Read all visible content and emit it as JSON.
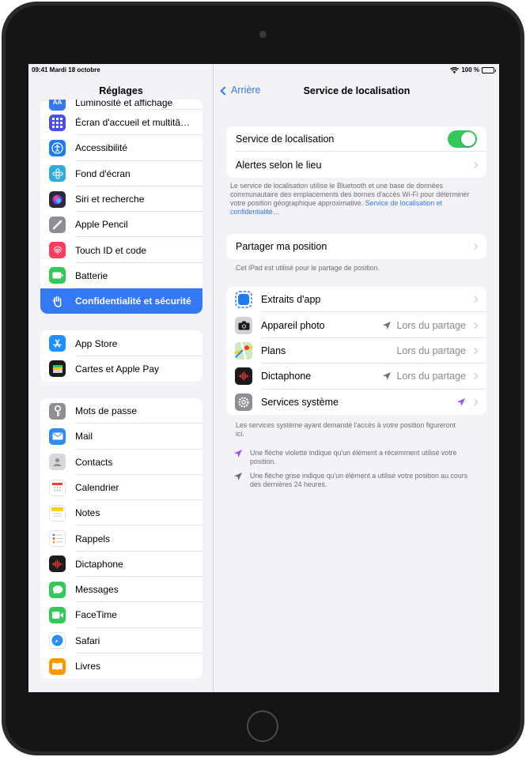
{
  "statusbar": {
    "time_date": "09:41  Mardi 18 octobre",
    "battery": "100 %"
  },
  "sidebar": {
    "title": "Réglages",
    "groups": [
      [
        {
          "label": "Luminosité et affichage",
          "color": "#3478f6"
        },
        {
          "label": "Écran d'accueil et multitâ…",
          "color": "#4b4de8"
        },
        {
          "label": "Accessibilité",
          "color": "#1e7cf2"
        },
        {
          "label": "Fond d'écran",
          "color": "#34aadc"
        },
        {
          "label": "Siri et recherche",
          "color": "#2a2a3a"
        },
        {
          "label": "Apple Pencil",
          "color": "#8e8e93"
        },
        {
          "label": "Touch ID et code",
          "color": "#ff3b5c"
        },
        {
          "label": "Batterie",
          "color": "#34c759"
        },
        {
          "label": "Confidentialité et sécurité",
          "color": "#3478f6"
        }
      ],
      [
        {
          "label": "App Store",
          "color": "#1e90ff"
        },
        {
          "label": "Cartes et Apple Pay",
          "color": "#1c1c1e"
        }
      ],
      [
        {
          "label": "Mots de passe",
          "color": "#8e8e93"
        },
        {
          "label": "Mail",
          "color": "#2d8cf0"
        },
        {
          "label": "Contacts",
          "color": "#a8a8ad"
        },
        {
          "label": "Calendrier",
          "color": "#ffffff"
        },
        {
          "label": "Notes",
          "color": "#ffd60a"
        },
        {
          "label": "Rappels",
          "color": "#ffffff"
        },
        {
          "label": "Dictaphone",
          "color": "#1c1c1e"
        },
        {
          "label": "Messages",
          "color": "#34c759"
        },
        {
          "label": "FaceTime",
          "color": "#34c759"
        },
        {
          "label": "Safari",
          "color": "#1e90ff"
        },
        {
          "label": "Livres",
          "color": "#ff9500"
        }
      ]
    ]
  },
  "detail": {
    "back_label": "Arrière",
    "title": "Service de localisation",
    "location_service_label": "Service de localisation",
    "location_service_on": true,
    "alerts_label": "Alertes selon le lieu",
    "info_text": "Le service de localisation utilise le Bluetooth et une base de données communautaire des emplacements des bornes d'accès Wi-Fi pour déterminer votre position géographique approximative.",
    "info_link": "Service de localisation et confidentialité…",
    "share_label": "Partager ma position",
    "share_note": "Cet iPad est utilisé pour le partage de position.",
    "apps": [
      {
        "label": "Extraits d'app",
        "status": "",
        "arrow": ""
      },
      {
        "label": "Appareil photo",
        "status": "Lors du partage",
        "arrow": "gray"
      },
      {
        "label": "Plans",
        "status": "Lors du partage",
        "arrow": ""
      },
      {
        "label": "Dictaphone",
        "status": "Lors du partage",
        "arrow": "gray"
      },
      {
        "label": "Services système",
        "status": "",
        "arrow": "purple"
      }
    ],
    "system_note": "Les services système ayant demandé l'accès à votre position figureront ici.",
    "legend_purple": "Une flèche violette indique qu'un élément a récemment utilisé votre position.",
    "legend_gray": "Une flèche grise indique qu'un élément a utilisé votre position au cours des dernières 24 heures.",
    "colors": {
      "accent": "#3478f6",
      "toggle_on": "#34c759",
      "arrow_purple": "#a550f0",
      "arrow_gray": "#6d6d72"
    }
  }
}
